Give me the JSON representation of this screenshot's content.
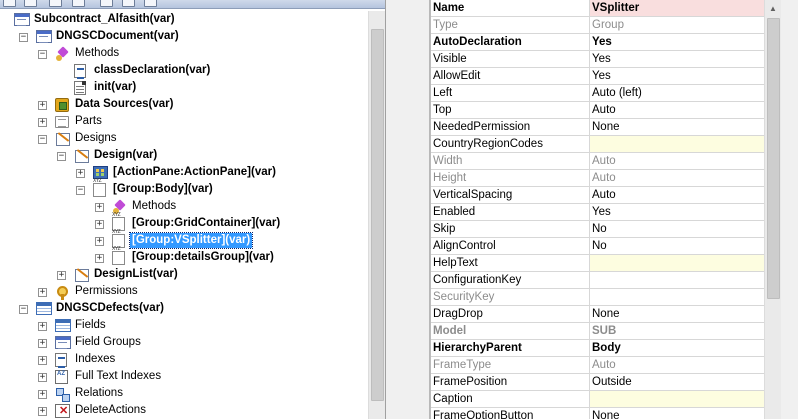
{
  "tree": {
    "items": [
      {
        "label": "Subcontract_Alfasith(var)",
        "bold": true,
        "level": 0,
        "icon": "form-icon",
        "expander": "",
        "iconType": "form"
      },
      {
        "label": "DNGSCDocument(var)",
        "bold": true,
        "level": 1,
        "icon": "form-icon",
        "expander": "−",
        "iconType": "form"
      },
      {
        "label": "Methods",
        "bold": false,
        "level": 2,
        "icon": "methods-icon",
        "expander": "−",
        "iconType": "methods"
      },
      {
        "label": "classDeclaration(var)",
        "bold": true,
        "level": 3,
        "icon": "class-declaration-icon",
        "expander": "",
        "iconType": "script"
      },
      {
        "label": "init(var)",
        "bold": true,
        "level": 3,
        "icon": "method-icon",
        "expander": "",
        "iconType": "doc"
      },
      {
        "label": "Data Sources(var)",
        "bold": true,
        "level": 2,
        "icon": "data-sources-icon",
        "expander": "+",
        "iconType": "datasrc"
      },
      {
        "label": "Parts",
        "bold": false,
        "level": 2,
        "icon": "parts-icon",
        "expander": "+",
        "iconType": "folder"
      },
      {
        "label": "Designs",
        "bold": false,
        "level": 2,
        "icon": "designs-icon",
        "expander": "−",
        "iconType": "design"
      },
      {
        "label": "Design(var)",
        "bold": true,
        "level": 3,
        "icon": "design-icon",
        "expander": "−",
        "iconType": "design"
      },
      {
        "label": "[ActionPane:ActionPane](var)",
        "bold": true,
        "level": 4,
        "icon": "action-pane-icon",
        "expander": "+",
        "iconType": "actionpane"
      },
      {
        "label": "[Group:Body](var)",
        "bold": true,
        "level": 4,
        "icon": "group-icon",
        "expander": "−",
        "iconType": "group"
      },
      {
        "label": "Methods",
        "bold": false,
        "level": 5,
        "icon": "methods-icon",
        "expander": "+",
        "iconType": "methods"
      },
      {
        "label": "[Group:GridContainer](var)",
        "bold": true,
        "level": 5,
        "icon": "group-icon",
        "expander": "+",
        "iconType": "group"
      },
      {
        "label": "[Group:VSplitter](var)",
        "bold": true,
        "level": 5,
        "icon": "group-icon",
        "expander": "+",
        "iconType": "group",
        "selected": true
      },
      {
        "label": "[Group:detailsGroup](var)",
        "bold": true,
        "level": 5,
        "icon": "group-icon",
        "expander": "+",
        "iconType": "group"
      },
      {
        "label": "DesignList(var)",
        "bold": true,
        "level": 3,
        "icon": "design-list-icon",
        "expander": "+",
        "iconType": "design"
      },
      {
        "label": "Permissions",
        "bold": false,
        "level": 2,
        "icon": "key-icon",
        "expander": "+",
        "iconType": "key"
      },
      {
        "label": "DNGSCDefects(var)",
        "bold": true,
        "level": 1,
        "icon": "table-icon",
        "expander": "−",
        "iconType": "table"
      },
      {
        "label": "Fields",
        "bold": false,
        "level": 2,
        "icon": "fields-icon",
        "expander": "+",
        "iconType": "table"
      },
      {
        "label": "Field Groups",
        "bold": false,
        "level": 2,
        "icon": "field-groups-icon",
        "expander": "+",
        "iconType": "form"
      },
      {
        "label": "Indexes",
        "bold": false,
        "level": 2,
        "icon": "indexes-icon",
        "expander": "+",
        "iconType": "script"
      },
      {
        "label": "Full Text Indexes",
        "bold": false,
        "level": 2,
        "icon": "full-text-indexes-icon",
        "expander": "+",
        "iconType": "az"
      },
      {
        "label": "Relations",
        "bold": false,
        "level": 2,
        "icon": "relations-icon",
        "expander": "+",
        "iconType": "relations"
      },
      {
        "label": "DeleteActions",
        "bold": false,
        "level": 2,
        "icon": "delete-actions-icon",
        "expander": "+",
        "iconType": "delete"
      }
    ]
  },
  "properties": {
    "rows": [
      {
        "name": "Name",
        "value": "VSplitter",
        "bold": true,
        "grey": false,
        "bg": "pink"
      },
      {
        "name": "Type",
        "value": "Group",
        "bold": false,
        "grey": true,
        "bg": ""
      },
      {
        "name": "AutoDeclaration",
        "value": "Yes",
        "bold": true,
        "grey": false,
        "bg": ""
      },
      {
        "name": "Visible",
        "value": "Yes",
        "bold": false,
        "grey": false,
        "bg": ""
      },
      {
        "name": "AllowEdit",
        "value": "Yes",
        "bold": false,
        "grey": false,
        "bg": ""
      },
      {
        "name": "Left",
        "value": "Auto (left)",
        "bold": false,
        "grey": false,
        "bg": ""
      },
      {
        "name": "Top",
        "value": "Auto",
        "bold": false,
        "grey": false,
        "bg": ""
      },
      {
        "name": "NeededPermission",
        "value": "None",
        "bold": false,
        "grey": false,
        "bg": ""
      },
      {
        "name": "CountryRegionCodes",
        "value": "",
        "bold": false,
        "grey": false,
        "bg": "yellow"
      },
      {
        "name": "Width",
        "value": "Auto",
        "bold": false,
        "grey": true,
        "bg": ""
      },
      {
        "name": "Height",
        "value": "Auto",
        "bold": false,
        "grey": true,
        "bg": ""
      },
      {
        "name": "VerticalSpacing",
        "value": "Auto",
        "bold": false,
        "grey": false,
        "bg": ""
      },
      {
        "name": "Enabled",
        "value": "Yes",
        "bold": false,
        "grey": false,
        "bg": ""
      },
      {
        "name": "Skip",
        "value": "No",
        "bold": false,
        "grey": false,
        "bg": ""
      },
      {
        "name": "AlignControl",
        "value": "No",
        "bold": false,
        "grey": false,
        "bg": ""
      },
      {
        "name": "HelpText",
        "value": "",
        "bold": false,
        "grey": false,
        "bg": "yellow"
      },
      {
        "name": "ConfigurationKey",
        "value": "",
        "bold": false,
        "grey": false,
        "bg": ""
      },
      {
        "name": "SecurityKey",
        "value": "",
        "bold": false,
        "grey": true,
        "bg": ""
      },
      {
        "name": "DragDrop",
        "value": "None",
        "bold": false,
        "grey": false,
        "bg": ""
      },
      {
        "name": "Model",
        "value": "SUB",
        "bold": true,
        "grey": true,
        "bg": ""
      },
      {
        "name": "HierarchyParent",
        "value": "Body",
        "bold": true,
        "grey": false,
        "bg": ""
      },
      {
        "name": "FrameType",
        "value": "Auto",
        "bold": false,
        "grey": true,
        "bg": ""
      },
      {
        "name": "FramePosition",
        "value": "Outside",
        "bold": false,
        "grey": false,
        "bg": ""
      },
      {
        "name": "Caption",
        "value": "",
        "bold": false,
        "grey": false,
        "bg": "yellow"
      },
      {
        "name": "FrameOptionButton",
        "value": "None",
        "bold": false,
        "grey": false,
        "bg": ""
      }
    ]
  },
  "colors": {
    "selection": "#3399ff",
    "pink_value": "#f9dede",
    "yellow_value": "#fdfde0",
    "grey_text": "#8c8c8c"
  }
}
